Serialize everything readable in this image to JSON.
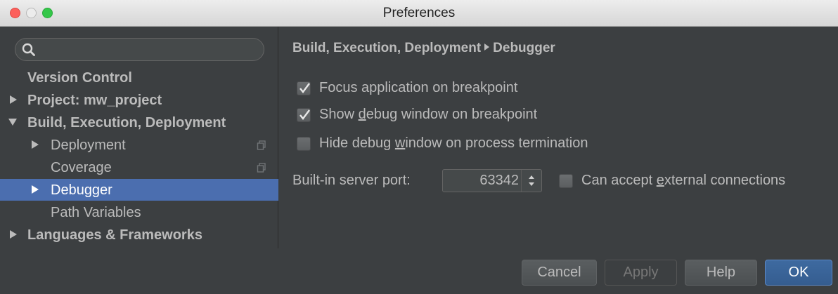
{
  "window": {
    "title": "Preferences"
  },
  "sidebar": {
    "search": {
      "placeholder": ""
    },
    "items": [
      {
        "label": "Version Control",
        "expander": "none"
      },
      {
        "label": "Project: mw_project",
        "expander": "collapsed"
      },
      {
        "label": "Build, Execution, Deployment",
        "expander": "expanded"
      },
      {
        "label": "Deployment",
        "expander": "collapsed",
        "icon": "copy-icon"
      },
      {
        "label": "Coverage",
        "expander": "none",
        "icon": "copy-icon"
      },
      {
        "label": "Debugger",
        "expander": "collapsed",
        "selected": true
      },
      {
        "label": "Path Variables",
        "expander": "none"
      },
      {
        "label": "Languages & Frameworks",
        "expander": "collapsed"
      }
    ]
  },
  "content": {
    "breadcrumb": {
      "parent": "Build, Execution, Deployment",
      "current": "Debugger"
    },
    "options": [
      {
        "pre": "Focus application on breakpoint",
        "mnemonic": "",
        "post": "",
        "checked": true
      },
      {
        "pre": "Show ",
        "mnemonic": "d",
        "post": "ebug window on breakpoint",
        "checked": true
      },
      {
        "pre": "Hide debug ",
        "mnemonic": "w",
        "post": "indow on process termination",
        "checked": false
      }
    ],
    "port": {
      "label": "Built-in server port:",
      "value": "63342"
    },
    "external": {
      "pre": "Can accept ",
      "mnemonic": "e",
      "post": "xternal connections",
      "checked": false
    }
  },
  "footer": {
    "cancel": "Cancel",
    "apply": "Apply",
    "help": "Help",
    "ok": "OK"
  },
  "colors": {
    "background": "#3c3f41",
    "selection": "#4b6eaf",
    "text": "#bbbbbb",
    "ok_button": "#365f93",
    "close": "#fc605c",
    "maximize": "#34c749"
  }
}
